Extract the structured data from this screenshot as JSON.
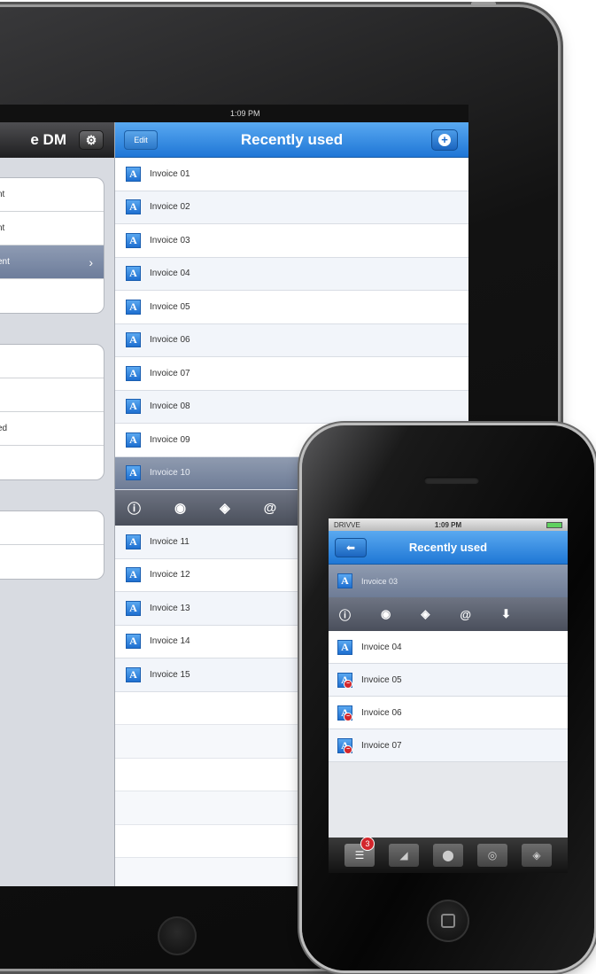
{
  "ipad": {
    "status_time": "1:09 PM",
    "master": {
      "title": "e DM",
      "settings_icon": "gear-icon",
      "group1": [
        "nt",
        "nt",
        "ent",
        "t"
      ],
      "group2": [
        "",
        "",
        "ed",
        ""
      ],
      "group3": [
        "",
        ""
      ]
    },
    "detail": {
      "edit_label": "Edit",
      "title": "Recently used",
      "add_icon": "plus-icon",
      "rows_before": [
        "Invoice 01",
        "Invoice 02",
        "Invoice 03",
        "Invoice 04",
        "Invoice 05",
        "Invoice 06",
        "Invoice 07",
        "Invoice 08",
        "Invoice 09"
      ],
      "selected_row": "Invoice 10",
      "actions": [
        "info-icon",
        "eye-icon",
        "navigate-icon",
        "at-icon"
      ],
      "rows_after": [
        "Invoice 11",
        "Invoice 12",
        "Invoice 13",
        "Invoice 14",
        "Invoice 15"
      ]
    }
  },
  "iphone": {
    "status": {
      "carrier": "DRIVVE",
      "time": "1:09 PM"
    },
    "back_icon": "arrow-left-icon",
    "title": "Recently used",
    "selected_row": "Invoice 03",
    "actions": [
      "info-icon",
      "eye-icon",
      "navigate-icon",
      "at-icon",
      "download-icon"
    ],
    "rows": [
      "Invoice 04",
      "Invoice 05",
      "Invoice 06",
      "Invoice 07"
    ],
    "tab_badge": "3",
    "tabs": [
      "list-icon",
      "edit-icon",
      "circle-icon",
      "target-icon",
      "navigate-icon"
    ]
  }
}
